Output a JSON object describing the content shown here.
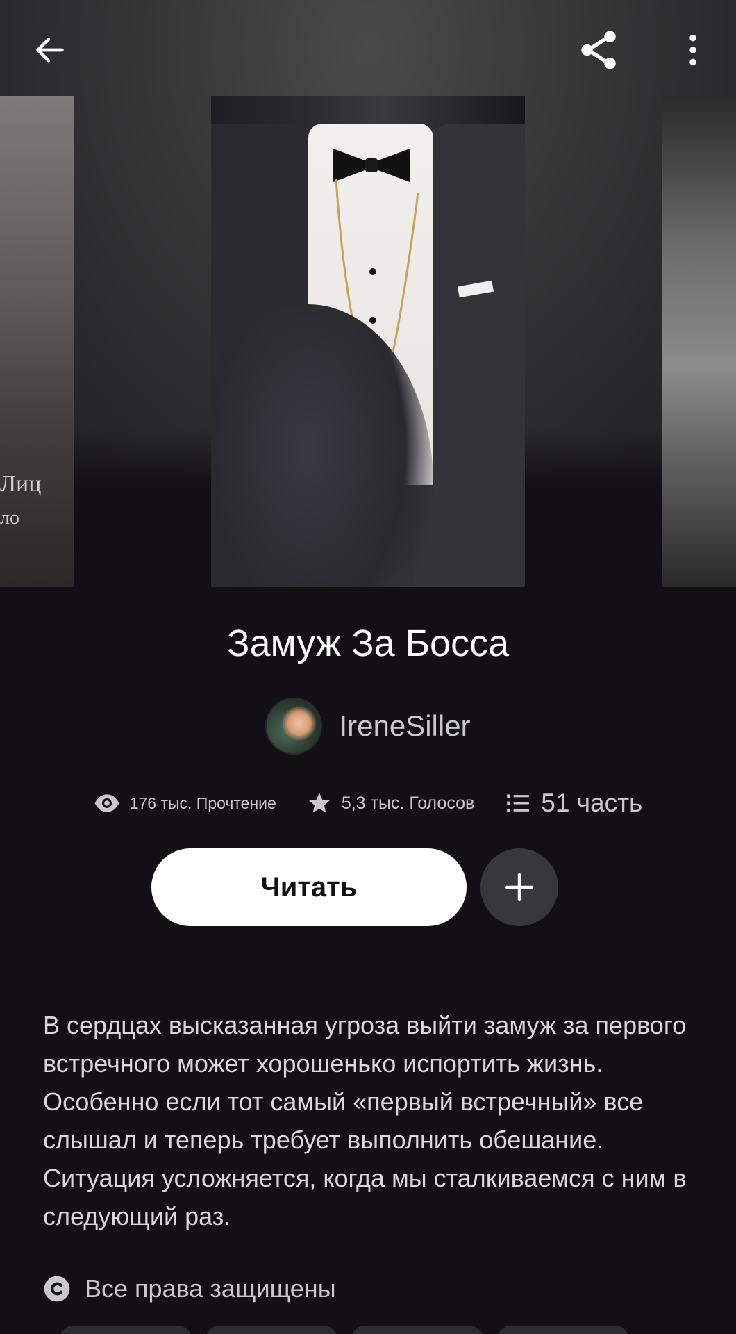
{
  "header": {
    "back_icon": "arrow-left-icon",
    "share_icon": "share-icon",
    "more_icon": "more-vertical-icon"
  },
  "carousel": {
    "left_cover_text": "Лиц\nло",
    "left_cover_caption_top": "Лиц",
    "left_cover_caption_bottom": "ло"
  },
  "story": {
    "title": "Замуж За Босса",
    "author": "IreneSiller",
    "stats": {
      "reads": "176 тыс. Прочтение",
      "votes": "5,3 тыс. Голосов",
      "parts": "51 часть"
    },
    "read_button_label": "Читать",
    "add_icon": "plus-icon",
    "description": "В сердцах высказанная угроза выйти замуж за первого встречного может хорошенько испортить жизнь. Особенно если тот самый «первый встречный» все слышал и теперь требует выполнить обешание. Ситуация усложняется, когда мы сталкиваемся с ним в следующий раз.",
    "copyright": "Все права защищены"
  },
  "colors": {
    "background": "#121014",
    "accent_button": "#ffffff",
    "secondary_button": "#38373c",
    "muted_text": "#c9c9cc"
  }
}
